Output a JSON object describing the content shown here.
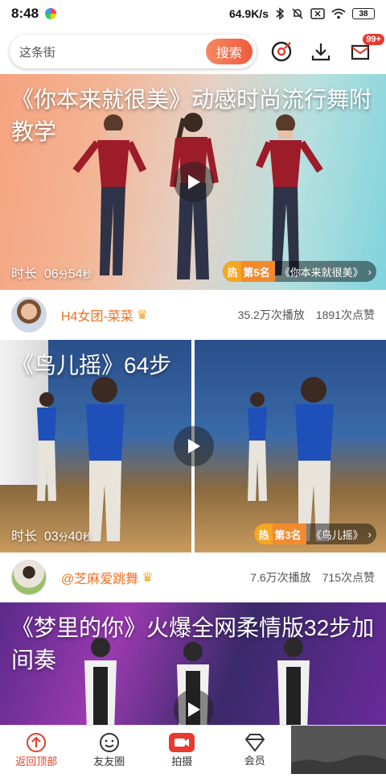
{
  "status_bar": {
    "time": "8:48",
    "net_speed": "64.9K/s",
    "battery": "38"
  },
  "search": {
    "placeholder": "这条街",
    "button_label": "搜索"
  },
  "toolbar": {
    "mailbox_badge": "99+"
  },
  "feed": [
    {
      "title": "《你本来就很美》动感时尚流行舞附教学",
      "duration_label": "时长",
      "duration_min": "06",
      "duration_sec": "54",
      "unit_min": "分",
      "unit_sec": "秒",
      "rank_hot": "热",
      "rank_no": "第5名",
      "rank_name": "《你本来就很美》",
      "author": "H4女团-菜菜",
      "plays": "35.2万次播放",
      "likes": "1891次点赞"
    },
    {
      "title": "《鸟儿摇》64步",
      "duration_label": "时长",
      "duration_min": "03",
      "duration_sec": "40",
      "unit_min": "分",
      "unit_sec": "秒",
      "rank_hot": "热",
      "rank_no": "第3名",
      "rank_name": "《鸟儿摇》",
      "author": "@芝麻爱跳舞",
      "plays": "7.6万次播放",
      "likes": "715次点赞"
    },
    {
      "title": "《梦里的你》火爆全网柔情版32步加间奏"
    }
  ],
  "bottom_nav": [
    {
      "label": "返回顶部",
      "icon": "arrow-up-circle-icon",
      "active": true
    },
    {
      "label": "友友圈",
      "icon": "smiley-icon"
    },
    {
      "label": "拍摄",
      "icon": "camera-icon"
    },
    {
      "label": "会员",
      "icon": "diamond-icon"
    }
  ],
  "colors": {
    "accent": "#e0402a",
    "author": "#f07020",
    "search_button": "#ee5a3c"
  }
}
